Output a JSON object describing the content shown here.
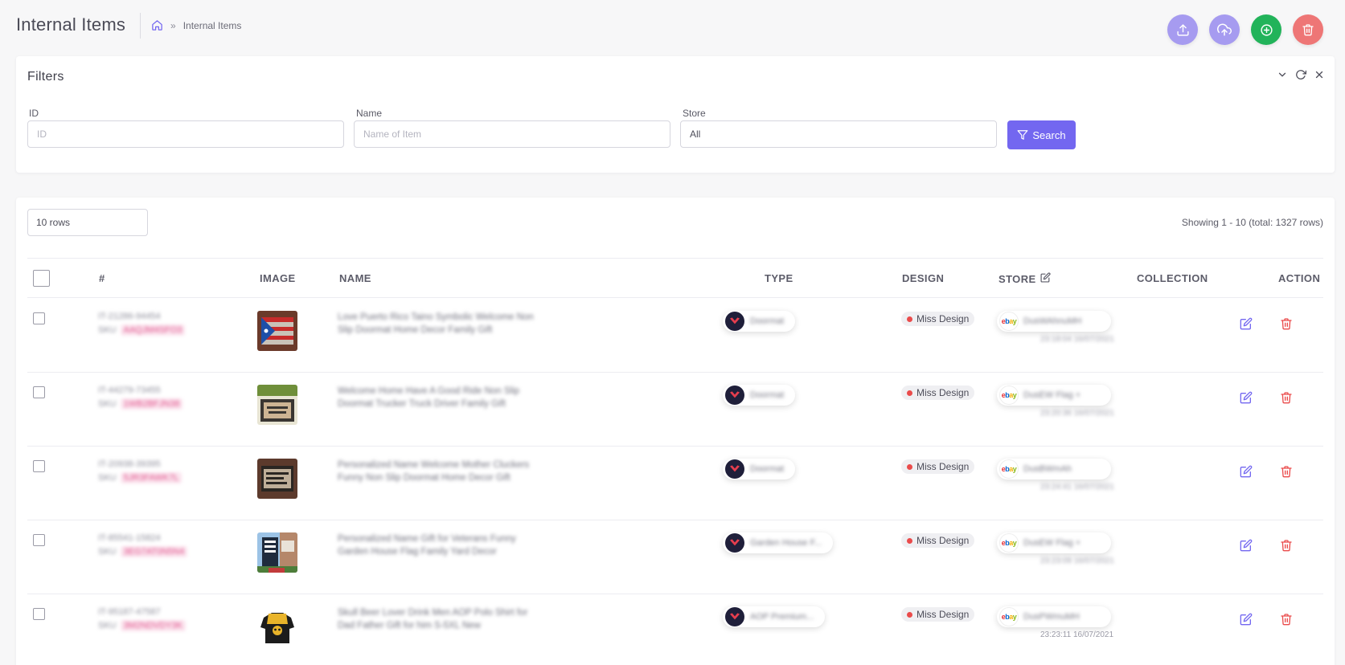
{
  "page": {
    "title": "Internal Items"
  },
  "breadcrumb": {
    "home_icon": "home-icon",
    "separator": "»",
    "current": "Internal Items"
  },
  "top_actions": [
    {
      "name": "export-button",
      "icon": "export-icon",
      "color": "#a69bf0"
    },
    {
      "name": "upload-button",
      "icon": "cloud-upload-icon",
      "color": "#a69bf0"
    },
    {
      "name": "add-item-button",
      "icon": "plus-circle-icon",
      "color": "#22b35a"
    },
    {
      "name": "delete-selected-button",
      "icon": "trash-icon",
      "color": "#ee7676"
    }
  ],
  "filters": {
    "title": "Filters",
    "tools": [
      "chevron-down-icon",
      "refresh-icon",
      "close-icon"
    ],
    "id": {
      "label": "ID",
      "placeholder": "ID",
      "value": ""
    },
    "name": {
      "label": "Name",
      "placeholder": "Name of Item",
      "value": ""
    },
    "store": {
      "label": "Store",
      "value": "All"
    },
    "search_label": "Search"
  },
  "table": {
    "rows_per_page": "10 rows",
    "showing": "Showing 1 - 10 (total: 1327 rows)",
    "columns": [
      "#",
      "IMAGE",
      "NAME",
      "TYPE",
      "DESIGN",
      "STORE",
      "COLLECTION",
      "ACTION"
    ],
    "rows": [
      {
        "id": "IT-21286-94454",
        "sku_label": "SKU",
        "sku": "AAQJM4SFO3",
        "name": "Love Puerto Rico Taino Symbolic Welcome Non Slip Doormat Home Decor Family Gift",
        "type": "Doormat",
        "design": "Miss Design",
        "store": "DusWAhnuMH",
        "store_time": "23:18:04 16/07/2021"
      },
      {
        "id": "IT-44279-73455",
        "sku_label": "SKU",
        "sku": "1WB2BFJN38",
        "name": "Welcome Home Have A Good Ride Non Slip Doormat Trucker Truck Driver Family Gift",
        "type": "Doormat",
        "design": "Miss Design",
        "store": "DusEW Flag +",
        "store_time": "23:20:36 16/07/2021"
      },
      {
        "id": "IT-20938-39395",
        "sku_label": "SKU",
        "sku": "5JR3FAWK7L",
        "name": "Personalized Name Welcome Mother Cluckers Funny Non Slip Doormat Home Decor Gift",
        "type": "Doormat",
        "design": "Miss Design",
        "store": "DusBWmAh",
        "store_time": "23:24:41 16/07/2021"
      },
      {
        "id": "IT-85541-15824",
        "sku_label": "SKU",
        "sku": "3EG7AT0N5N4",
        "name": "Personalized Name Gift for Veterans Funny Garden House Flag Family Yard Decor",
        "type": "Garden House F...",
        "design": "Miss Design",
        "store": "DusEW Flag +",
        "store_time": "23:23:09 16/07/2021"
      },
      {
        "id": "IT-95187-47587",
        "sku_label": "SKU",
        "sku": "3M2NDVDY3K",
        "name": "Skull Beer Lover Drink Men AOP Polo Shirt for Dad Father Gift for him S-5XL New",
        "type": "AOP Premium...",
        "design": "Miss Design",
        "store": "DusPWmuMH",
        "store_time": "23:23:11 16/07/2021"
      }
    ]
  }
}
